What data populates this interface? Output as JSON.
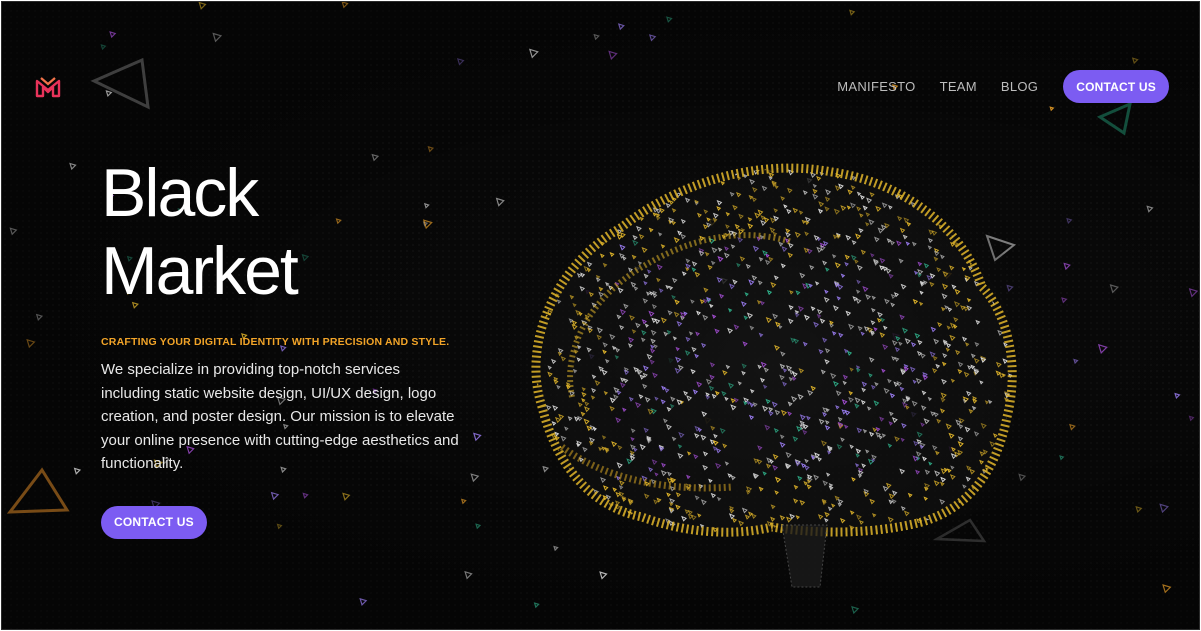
{
  "brand": {
    "logo_icon": "bm-monogram-logo",
    "accent_color": "#7c5cf2",
    "highlight_color": "#f2a428"
  },
  "nav": {
    "items": [
      {
        "label": "MANIFESTO"
      },
      {
        "label": "TEAM"
      },
      {
        "label": "BLOG"
      }
    ],
    "cta_label": "CONTACT US"
  },
  "hero": {
    "title_line1": "Black",
    "title_line2": "Market",
    "tagline": "CRAFTING YOUR DIGITAL IDENTITY WITH PRECISION AND STYLE.",
    "description": "We specialize in providing top-notch services including static website design, UI/UX design, logo creation, and poster design. Our mission is to elevate your online presence with cutting-edge aesthetics and functionality.",
    "cta_label": "CONTACT US"
  },
  "visual": {
    "illustration_icon": "particle-brain-illustration"
  }
}
